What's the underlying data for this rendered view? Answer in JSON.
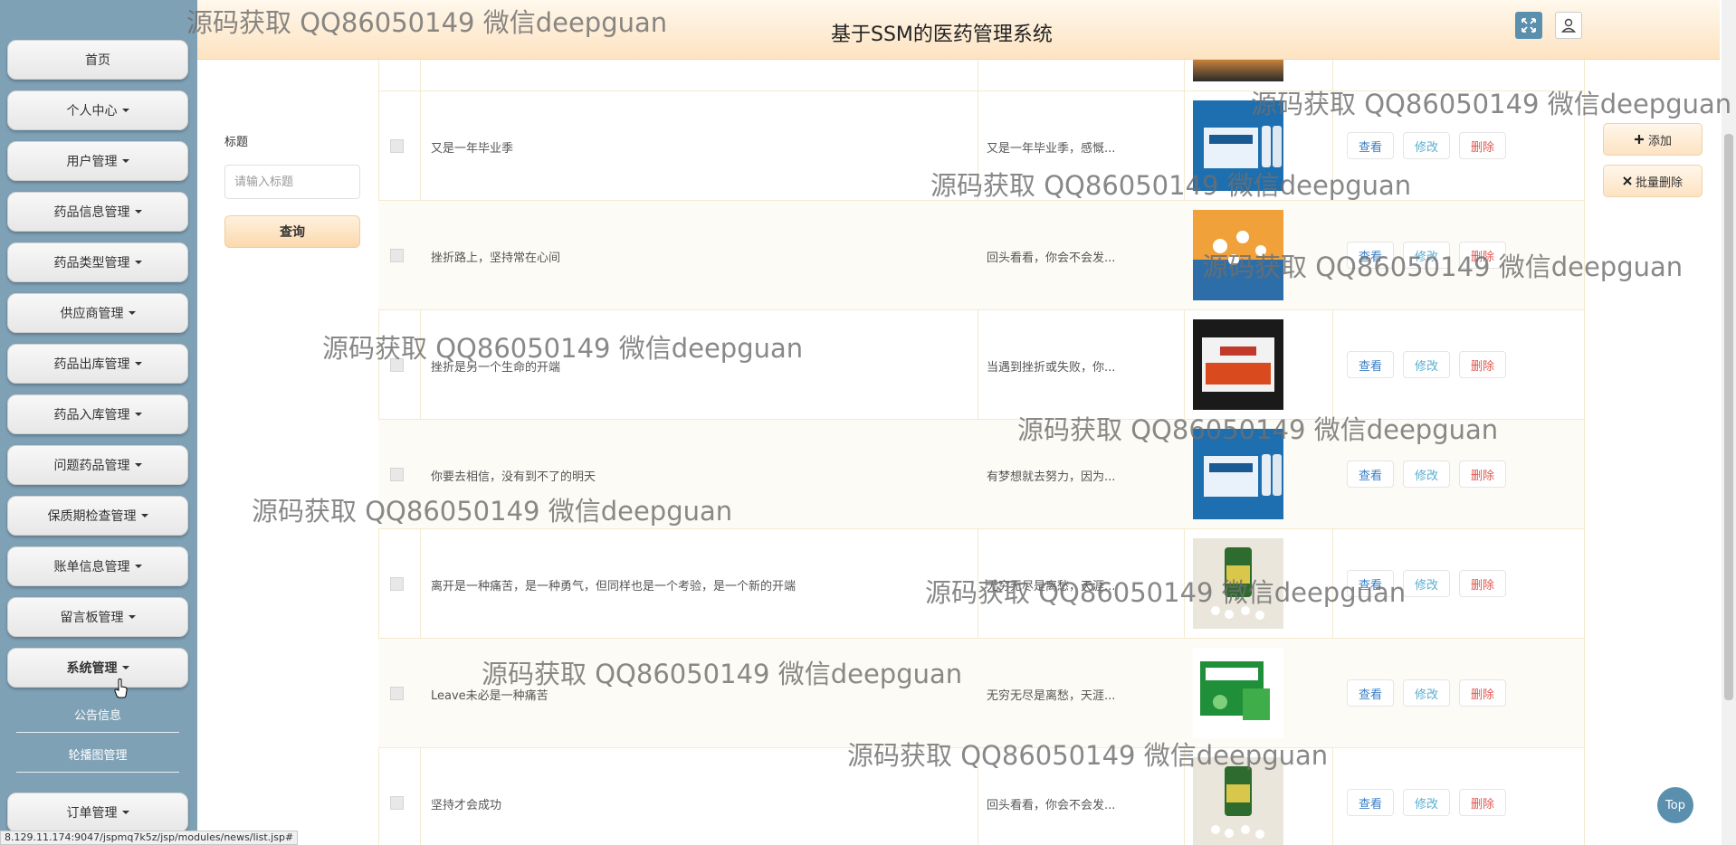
{
  "header": {
    "title": "基于SSM的医药管理系统"
  },
  "sidebar": {
    "items": [
      {
        "label": "首页"
      },
      {
        "label": "个人中心"
      },
      {
        "label": "用户管理"
      },
      {
        "label": "药品信息管理"
      },
      {
        "label": "药品类型管理"
      },
      {
        "label": "供应商管理"
      },
      {
        "label": "药品出库管理"
      },
      {
        "label": "药品入库管理"
      },
      {
        "label": "问题药品管理"
      },
      {
        "label": "保质期检查管理"
      },
      {
        "label": "账单信息管理"
      },
      {
        "label": "留言板管理"
      },
      {
        "label": "系统管理"
      },
      {
        "label": "订单管理"
      }
    ],
    "subitems": [
      {
        "label": "公告信息"
      },
      {
        "label": "轮播图管理"
      }
    ]
  },
  "search": {
    "label": "标题",
    "placeholder": "请输入标题",
    "button": "查询"
  },
  "actions": {
    "add": "添加",
    "batch_delete": "批量删除"
  },
  "table": {
    "action_labels": {
      "view": "查看",
      "edit": "修改",
      "delete": "删除"
    },
    "rows": [
      {
        "title": "又是一年毕业季",
        "intro": "又是一年毕业季，感慨..."
      },
      {
        "title": "挫折路上，坚持常在心间",
        "intro": "回头看看，你会不会发..."
      },
      {
        "title": "挫折是另一个生命的开端",
        "intro": "当遇到挫折或失败，你..."
      },
      {
        "title": "你要去相信，没有到不了的明天",
        "intro": "有梦想就去努力，因为..."
      },
      {
        "title": "离开是一种痛苦，是一种勇气，但同样也是一个考验，是一个新的开端",
        "intro": "无穷无尽是离愁，天涯..."
      },
      {
        "title": "Leave未必是一种痛苦",
        "intro": "无穷无尽是离愁，天涯..."
      },
      {
        "title": "坚持才会成功",
        "intro": "回头看看，你会不会发..."
      }
    ]
  },
  "watermark": {
    "text": "源码获取 QQ86050149 微信deepguan"
  },
  "top_button": "Top",
  "status_url": "8.129.11.174:9047/jspmq7k5z/jsp/modules/news/list.jsp#"
}
